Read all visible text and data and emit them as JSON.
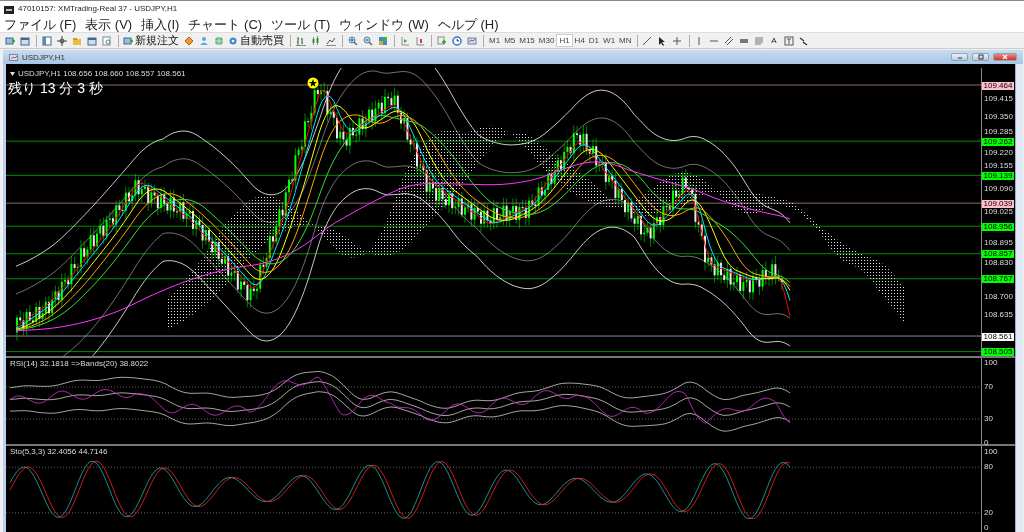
{
  "window": {
    "title": "47010157: XMTrading-Real 37 - USDJPY,H1"
  },
  "menu": [
    "ファイル (F)",
    "表示 (V)",
    "挿入(I)",
    "チャート (C)",
    "ツール (T)",
    "ウィンドウ (W)",
    "ヘルプ (H)"
  ],
  "toolbar": {
    "new_order": "新規注文",
    "auto_trading": "自動売買",
    "text_tool": "A",
    "timeframes": [
      {
        "label": "M1",
        "selected": false
      },
      {
        "label": "M5",
        "selected": false
      },
      {
        "label": "M15",
        "selected": false
      },
      {
        "label": "M30",
        "selected": false
      },
      {
        "label": "H1",
        "selected": true
      },
      {
        "label": "H4",
        "selected": false
      },
      {
        "label": "D1",
        "selected": false
      },
      {
        "label": "W1",
        "selected": false
      },
      {
        "label": "MN",
        "selected": false
      }
    ]
  },
  "chart_window": {
    "title": "USDJPY,H1",
    "info": "USDJPY,H1  108.656 108.660 108.557 108.561",
    "countdown": "残り 13 分 3 秒",
    "price_ticks": [
      "109.415",
      "109.350",
      "109.285",
      "109.220",
      "109.155",
      "109.090",
      "109.025",
      "108.895",
      "108.830",
      "108.700",
      "108.635"
    ],
    "level_lines": [
      {
        "price": "109.464",
        "color": "#ffc0cb"
      },
      {
        "price": "109.262",
        "color": "#00ff00"
      },
      {
        "price": "109.139",
        "color": "#00ff00"
      },
      {
        "price": "109.039",
        "color": "#ffc0cb"
      },
      {
        "price": "108.956",
        "color": "#00ff00"
      },
      {
        "price": "108.857",
        "color": "#00ff00"
      },
      {
        "price": "108.767",
        "color": "#00ff00"
      },
      {
        "price": "108.561",
        "color": "#ffffff"
      },
      {
        "price": "108.505",
        "color": "#00ff00"
      }
    ]
  },
  "rsi_panel": {
    "label": "RSI(14) 32.1818  =>Bands(20) 38.8022",
    "ticks": [
      "100",
      "70",
      "30",
      "0"
    ]
  },
  "stoch_panel": {
    "label": "Sto(5,3,3) 32.4056 44.7146",
    "ticks": [
      "100",
      "80",
      "20",
      "0"
    ]
  }
}
